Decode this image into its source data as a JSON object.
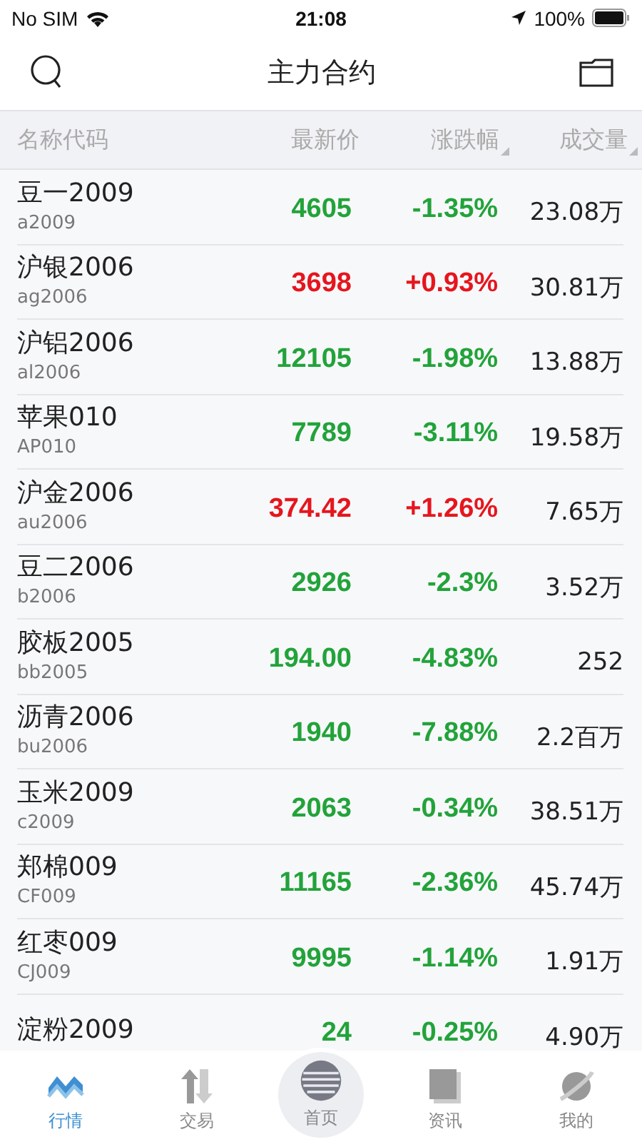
{
  "status_bar": {
    "carrier": "No SIM",
    "time": "21:08",
    "battery": "100%"
  },
  "header": {
    "title": "主力合约"
  },
  "table": {
    "columns": [
      {
        "label": "名称代码",
        "sortable": false
      },
      {
        "label": "最新价",
        "sortable": false
      },
      {
        "label": "涨跌幅",
        "sortable": true
      },
      {
        "label": "成交量",
        "sortable": true
      }
    ],
    "rows": [
      {
        "name": "豆一2009",
        "code": "a2009",
        "price": "4605",
        "change": "-1.35%",
        "volume": "23.08万",
        "color": "#22a33a"
      },
      {
        "name": "沪银2006",
        "code": "ag2006",
        "price": "3698",
        "change": "+0.93%",
        "volume": "30.81万",
        "color": "#e5161e"
      },
      {
        "name": "沪铝2006",
        "code": "al2006",
        "price": "12105",
        "change": "-1.98%",
        "volume": "13.88万",
        "color": "#22a33a"
      },
      {
        "name": "苹果010",
        "code": "AP010",
        "price": "7789",
        "change": "-3.11%",
        "volume": "19.58万",
        "color": "#22a33a"
      },
      {
        "name": "沪金2006",
        "code": "au2006",
        "price": "374.42",
        "change": "+1.26%",
        "volume": "7.65万",
        "color": "#e5161e"
      },
      {
        "name": "豆二2006",
        "code": "b2006",
        "price": "2926",
        "change": "-2.3%",
        "volume": "3.52万",
        "color": "#22a33a"
      },
      {
        "name": "胶板2005",
        "code": "bb2005",
        "price": "194.00",
        "change": "-4.83%",
        "volume": "252",
        "color": "#22a33a"
      },
      {
        "name": "沥青2006",
        "code": "bu2006",
        "price": "1940",
        "change": "-7.88%",
        "volume": "2.2百万",
        "color": "#22a33a"
      },
      {
        "name": "玉米2009",
        "code": "c2009",
        "price": "2063",
        "change": "-0.34%",
        "volume": "38.51万",
        "color": "#22a33a"
      },
      {
        "name": "郑棉009",
        "code": "CF009",
        "price": "11165",
        "change": "-2.36%",
        "volume": "45.74万",
        "color": "#22a33a"
      },
      {
        "name": "红枣009",
        "code": "CJ009",
        "price": "9995",
        "change": "-1.14%",
        "volume": "1.91万",
        "color": "#22a33a"
      },
      {
        "name": "淀粉2009",
        "price": "24",
        "change": "-0.25%",
        "volume": "4.90万",
        "color": "#22a33a"
      }
    ]
  },
  "tab_bar": [
    {
      "label": "行情",
      "kind": "chart",
      "selected": true
    },
    {
      "label": "交易",
      "kind": "trade",
      "selected": false
    },
    {
      "label": "首页",
      "kind": "home",
      "selected": false
    },
    {
      "label": "资讯",
      "kind": "news",
      "selected": false
    },
    {
      "label": "我的",
      "kind": "planet",
      "selected": false
    }
  ]
}
